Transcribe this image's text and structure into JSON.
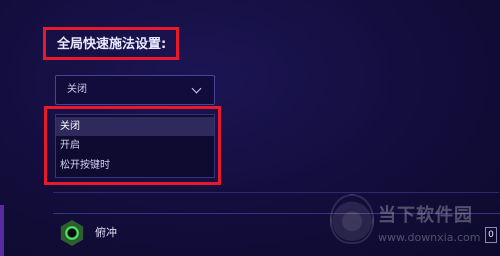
{
  "settings": {
    "section_title": "全局快速施法设置:",
    "quick_cast_select": {
      "selected_value": "关闭",
      "options": [
        "关闭",
        "开启",
        "松开按键时"
      ]
    }
  },
  "abilities": [
    {
      "name": "俯冲",
      "key": "0",
      "icon": "dive-ability-icon"
    }
  ],
  "watermark": {
    "title": "当下软件园",
    "url": "www.downxia.com"
  },
  "colors": {
    "highlight": "#e8192c",
    "background": "#130d3c",
    "border": "#4a4296"
  }
}
